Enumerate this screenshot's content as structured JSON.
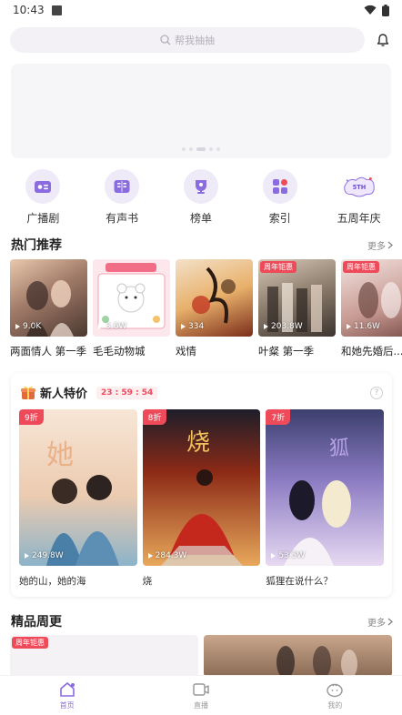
{
  "status": {
    "time": "10:43"
  },
  "search": {
    "placeholder": "帮我抽抽"
  },
  "categories": [
    {
      "label": "广播剧",
      "icon": "radio-icon"
    },
    {
      "label": "有声书",
      "icon": "audiobook-icon"
    },
    {
      "label": "榜单",
      "icon": "ranking-icon"
    },
    {
      "label": "索引",
      "icon": "index-icon"
    },
    {
      "label": "五周年庆",
      "icon": "anniversary-logo"
    }
  ],
  "hot": {
    "title": "热门推荐",
    "more": "更多",
    "items": [
      {
        "title": "两面情人 第一季",
        "plays": "9.0K",
        "tag": ""
      },
      {
        "title": "毛毛动物城",
        "plays": "3.6W",
        "tag": ""
      },
      {
        "title": "戏情",
        "plays": "334",
        "tag": ""
      },
      {
        "title": "叶粲 第一季",
        "plays": "203.8W",
        "tag": "周年钜惠"
      },
      {
        "title": "和她先婚后...",
        "plays": "11.6W",
        "tag": "周年钜惠"
      }
    ]
  },
  "promo": {
    "title": "新人特价",
    "timer": "23 : 59 : 54",
    "help": "?",
    "items": [
      {
        "title": "她的山，她的海",
        "discount": "9折",
        "plays": "249.8W"
      },
      {
        "title": "烧",
        "discount": "8折",
        "plays": "284.3W"
      },
      {
        "title": "狐狸在说什么？",
        "discount": "7折",
        "plays": "53.5W"
      }
    ]
  },
  "weekly": {
    "title": "精品周更",
    "more": "更多",
    "tag": "周年钜惠"
  },
  "tabs": [
    {
      "label": "首页",
      "icon": "home-icon"
    },
    {
      "label": "直播",
      "icon": "live-icon"
    },
    {
      "label": "我的",
      "icon": "profile-icon"
    }
  ],
  "colors": {
    "accent": "#8a6be0",
    "tag": "#ef4a5a",
    "icon_bg": "#efeaf8"
  }
}
